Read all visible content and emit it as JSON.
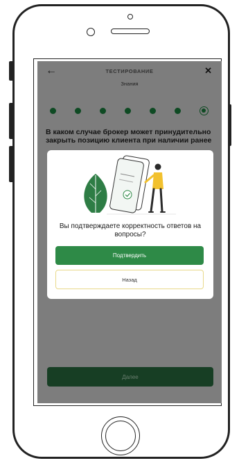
{
  "header": {
    "back_icon": "arrow-left-icon",
    "title": "ТЕСТИРОВАНИЕ",
    "close_icon": "close-icon",
    "subtitle": "Знания"
  },
  "progress": {
    "total_steps": 7,
    "current_step": 7
  },
  "question": {
    "text": "В каком случае брокер может принудительно закрыть позицию клиента при наличии ранее"
  },
  "modal": {
    "illustration": "person-with-phone-and-leaf-illustration",
    "message": "Вы подтверждаете корректность ответов на вопросы?",
    "confirm_label": "Подтвердить",
    "back_label": "Назад"
  },
  "footer": {
    "next_label": "Далее"
  },
  "colors": {
    "brand_green": "#2e8a47",
    "dark_green": "#0e4a23",
    "overlay_gray": "#7d7d7d",
    "back_border": "#e9d98a"
  }
}
